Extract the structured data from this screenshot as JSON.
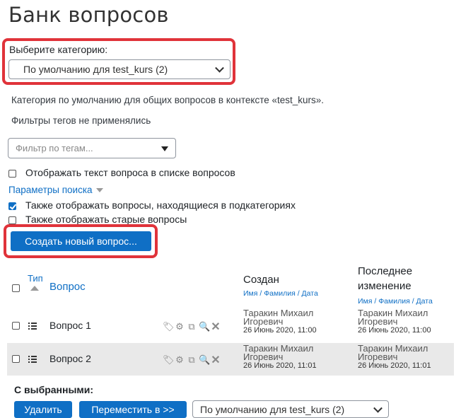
{
  "page": {
    "title": "Банк вопросов"
  },
  "category": {
    "label": "Выберите категорию:",
    "selected": "По умолчанию для test_kurs (2)",
    "description": "Категория по умолчанию для общих вопросов в контексте «test_kurs».",
    "tag_filters_note": "Фильтры тегов не применялись",
    "tag_filter_placeholder": "Фильтр по тегам..."
  },
  "options": {
    "show_text": "Отображать текст вопроса в списке вопросов",
    "search_params": "Параметры поиска",
    "subcategories": "Также отображать вопросы, находящиеся в подкатегориях",
    "old_questions": "Также отображать старые вопросы"
  },
  "create_button": "Создать новый вопрос...",
  "table": {
    "col_type": "Тип",
    "col_question": "Вопрос",
    "col_created": "Создан",
    "col_created_sub": "Имя / Фамилия / Дата",
    "col_modified_line1": "Последнее",
    "col_modified_line2": "изменение",
    "col_modified_sub": "Имя / Фамилия / Дата",
    "rows": [
      {
        "name": "Вопрос 1",
        "created_first": "Таракин Михаил",
        "created_last": "Игоревич",
        "created_date": "26 Июнь 2020, 11:00",
        "modified_first": "Таракин Михаил",
        "modified_last": "Игоревич",
        "modified_date": "26 Июнь 2020, 11:00"
      },
      {
        "name": "Вопрос 2",
        "created_first": "Таракин Михаил",
        "created_last": "Игоревич",
        "created_date": "26 Июнь 2020, 11:01",
        "modified_first": "Таракин Михаил",
        "modified_last": "Игоревич",
        "modified_date": "26 Июнь 2020, 11:01"
      }
    ]
  },
  "bulk": {
    "label": "С выбранными:",
    "delete": "Удалить",
    "move": "Переместить в >>",
    "target": "По умолчанию для test_kurs (2)"
  },
  "colors": {
    "accent": "#0f6fc5",
    "highlight": "#e0333a",
    "row_alt": "#e9e9e9"
  },
  "icons": [
    "tag-icon",
    "gear-icon",
    "copy-icon",
    "preview-icon",
    "delete-icon",
    "multichoice-icon",
    "sort-asc-icon"
  ]
}
